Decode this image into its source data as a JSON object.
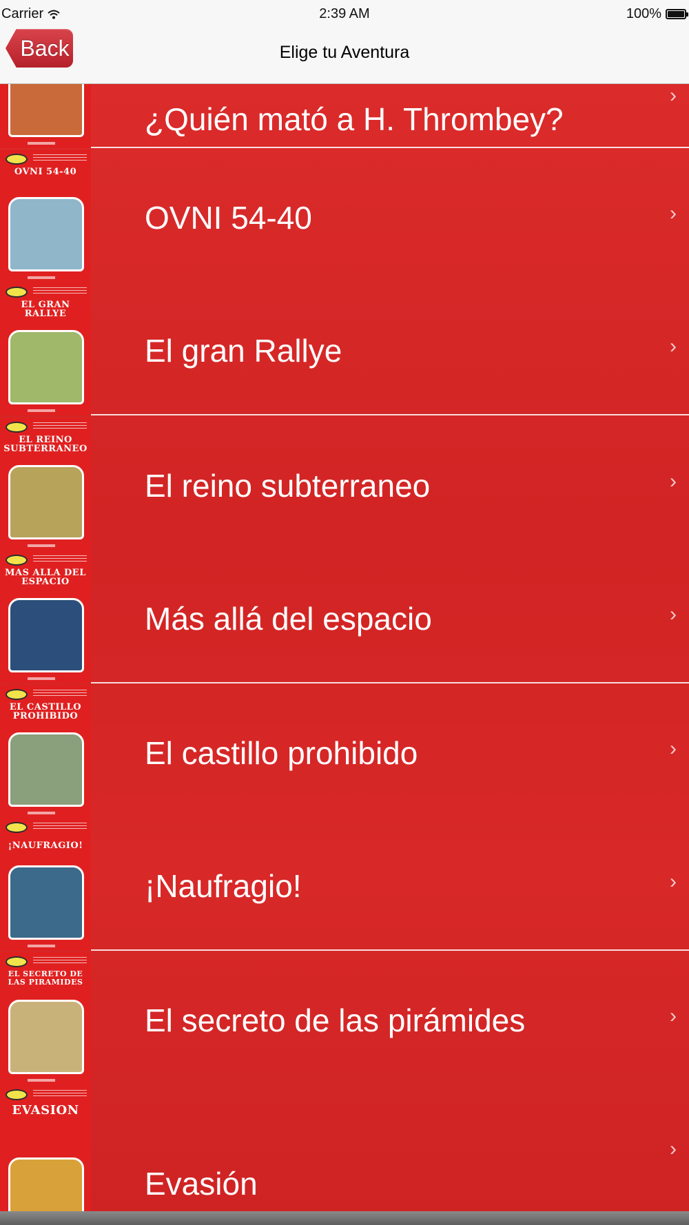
{
  "status_bar": {
    "carrier": "Carrier",
    "time": "2:39 AM",
    "battery": "100%"
  },
  "nav": {
    "back_label": "Back",
    "title": "Elige tu Aventura"
  },
  "books": [
    {
      "label": "¿Quién mató a H. Thrombey?",
      "cover_text": "",
      "art_color": "#c86a3a"
    },
    {
      "label": "OVNI 54-40",
      "cover_text": "OVNI 54-40",
      "art_color": "#8fb6c9"
    },
    {
      "label": "El gran Rallye",
      "cover_text": "EL GRAN RALLYE",
      "art_color": "#9fb86a"
    },
    {
      "label": "El reino subterraneo",
      "cover_text": "EL REINO SUBTERRANEO",
      "art_color": "#b7a35a"
    },
    {
      "label": "Más allá del espacio",
      "cover_text": "MAS ALLA DEL ESPACIO",
      "art_color": "#2b4f7a"
    },
    {
      "label": "El castillo prohibido",
      "cover_text": "EL CASTILLO PROHIBIDO",
      "art_color": "#8a9f7b"
    },
    {
      "label": "¡Naufragio!",
      "cover_text": "¡NAUFRAGIO!",
      "art_color": "#3c6a8a"
    },
    {
      "label": "El secreto de las pirámides",
      "cover_text": "EL SECRETO DE LAS PIRAMIDES",
      "art_color": "#c9b27a"
    },
    {
      "label": "Evasión",
      "cover_text": "EVASION",
      "art_color": "#d9a13a"
    }
  ],
  "colors": {
    "list_background": "#d62626",
    "back_button": "#c5303a"
  }
}
